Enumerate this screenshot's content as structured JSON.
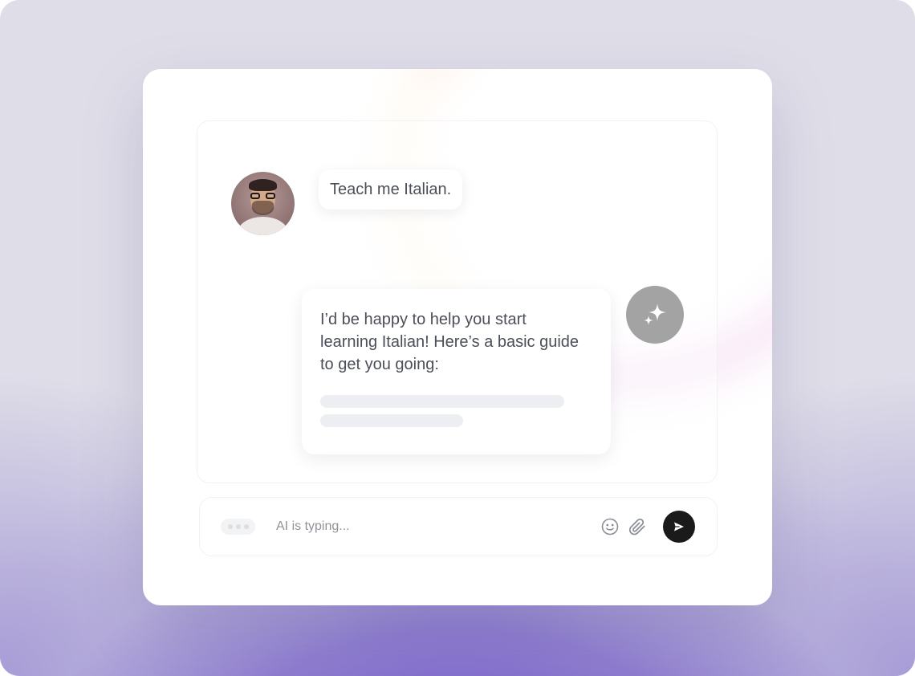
{
  "conversation": {
    "user_message": "Teach me Italian.",
    "ai_message": "I’d be happy to help you start learning Italian! Here’s a basic guide to get you going:"
  },
  "composer": {
    "status_text": "AI is typing..."
  },
  "icons": {
    "user_avatar": "user-avatar",
    "ai_avatar": "sparkles-icon",
    "emoji": "smiley-icon",
    "attach": "paperclip-icon",
    "send": "send-arrow-icon"
  },
  "colors": {
    "send_button": "#1a1a1a",
    "ai_avatar": "#a3a3a3",
    "background_accent": "#6c52c8"
  }
}
